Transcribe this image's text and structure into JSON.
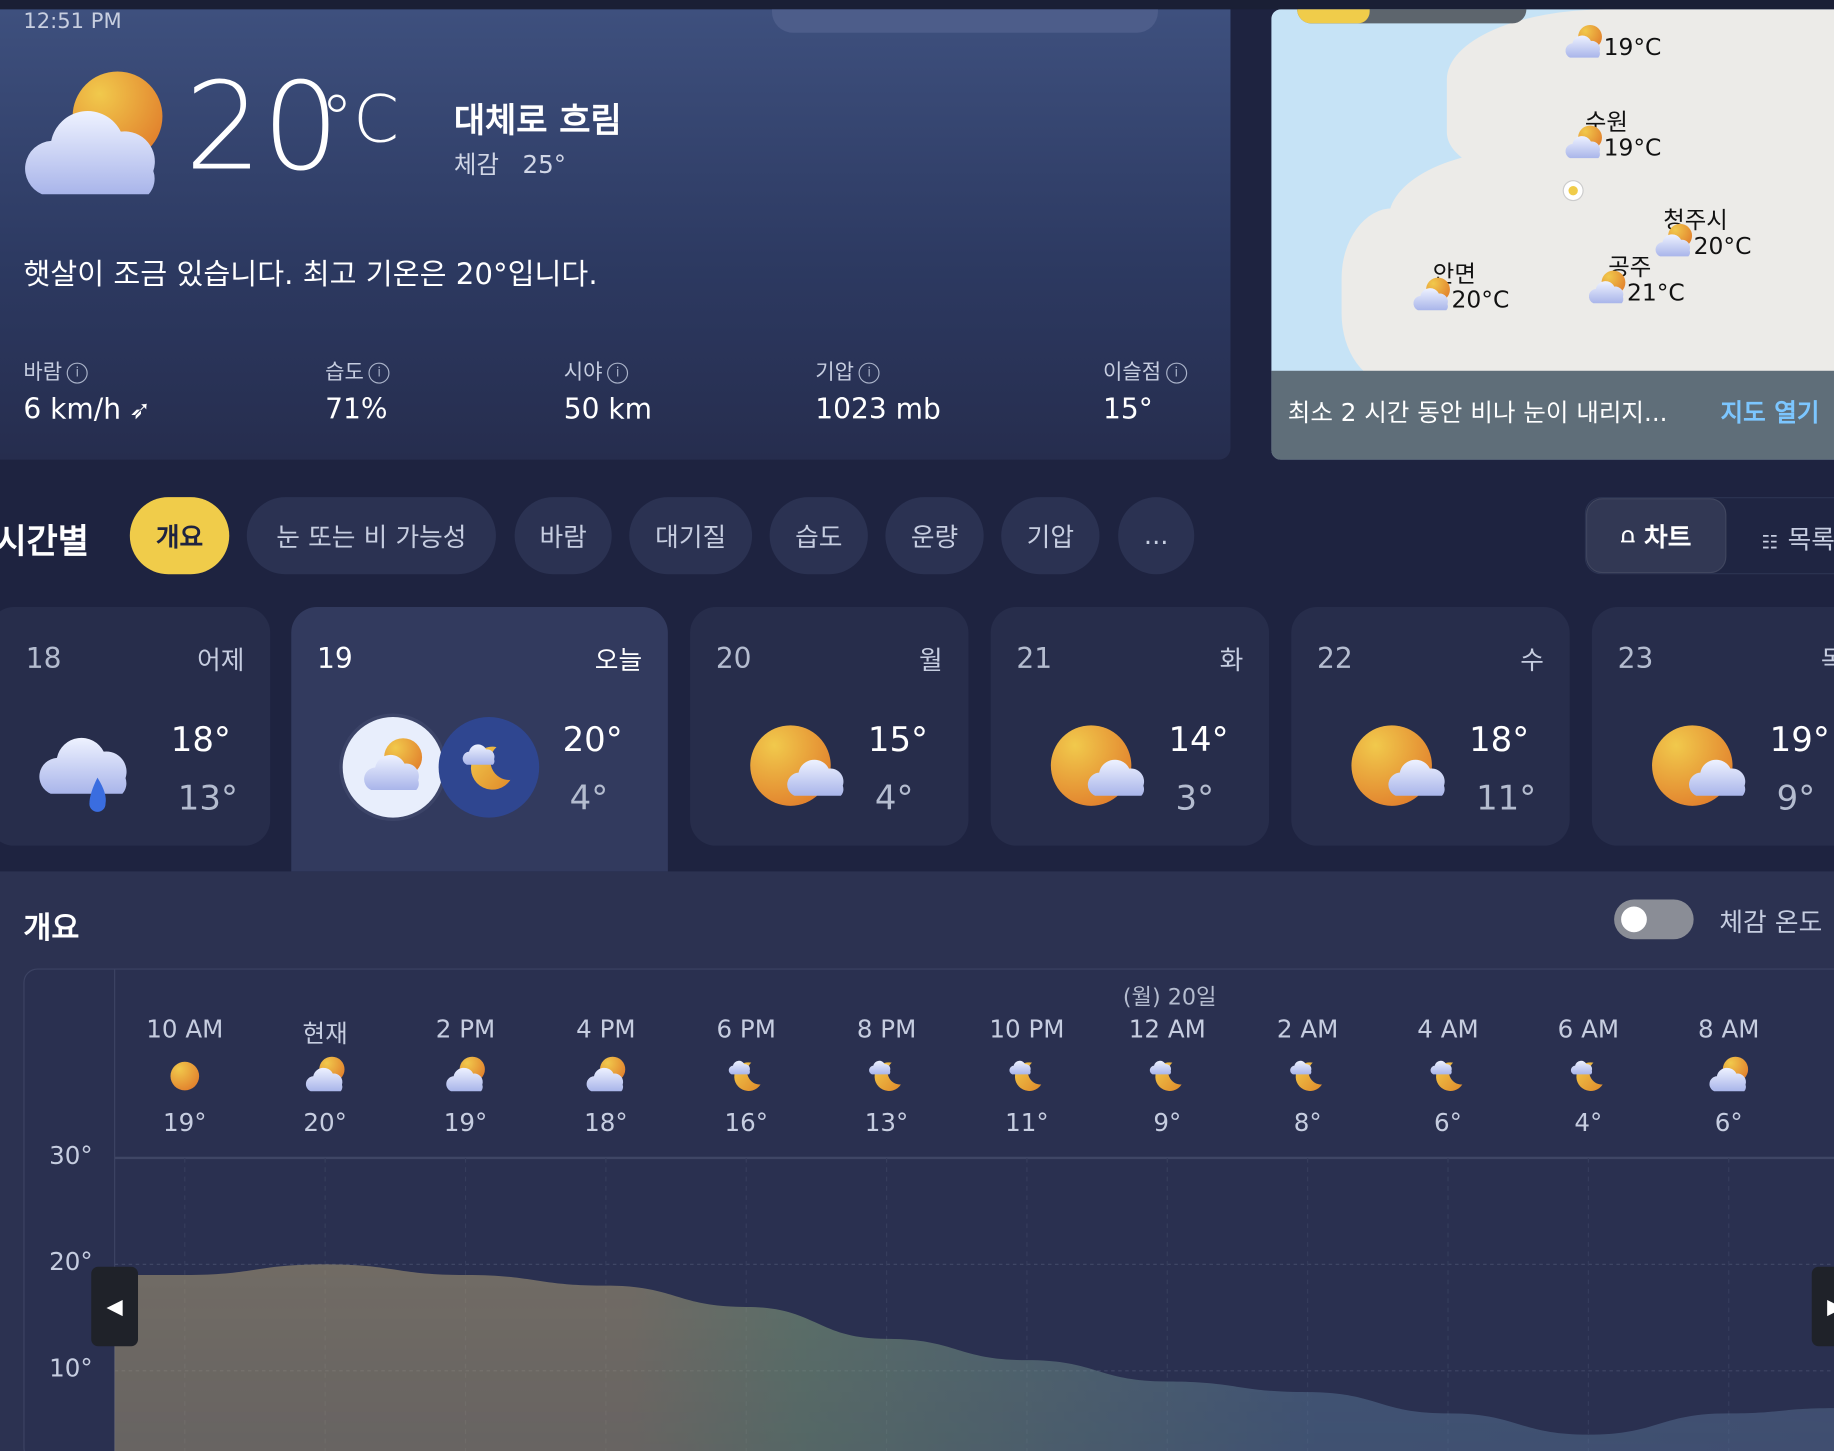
{
  "current": {
    "time": "12:51 PM",
    "temperature": "20",
    "unit": "°C",
    "condition": "대체로 흐림",
    "feels_like_label": "체감",
    "feels_like_value": "25°",
    "icon": "partly-sunny",
    "summary": "햇살이 조금 있습니다. 최고 기온은 20°입니다.",
    "stats": [
      {
        "label": "바람",
        "value": "6 km/h"
      },
      {
        "label": "습도",
        "value": "71%"
      },
      {
        "label": "시야",
        "value": "50 km"
      },
      {
        "label": "기압",
        "value": "1023 mb"
      },
      {
        "label": "이슬점",
        "value": "15°"
      }
    ],
    "info_icon": "i"
  },
  "map": {
    "markers": [
      {
        "name": "",
        "temp": "19°C"
      },
      {
        "name": "수원",
        "temp": "19°C"
      },
      {
        "name": "청주시",
        "temp": "20°C"
      },
      {
        "name": "공주",
        "temp": "21°C"
      },
      {
        "name": "안면",
        "temp": "20°C"
      }
    ],
    "message": "최소 2 시간 동안 비나 눈이 내리지...",
    "open_link": "지도 열기"
  },
  "hourly": {
    "title": "시간별",
    "tabs": [
      "개요",
      "눈 또는 비 가능성",
      "바람",
      "대기질",
      "습도",
      "운량",
      "기압",
      "..."
    ],
    "active_tab": 0,
    "view_chart": "차트",
    "view_list": "목록"
  },
  "days": [
    {
      "date": "18",
      "name": "어제",
      "hi": "18°",
      "lo": "13°",
      "icon": "rain"
    },
    {
      "date": "19",
      "name": "오늘",
      "hi": "20°",
      "lo": "4°",
      "icon": "day-night"
    },
    {
      "date": "20",
      "name": "월",
      "hi": "15°",
      "lo": "4°",
      "icon": "sun-cloud"
    },
    {
      "date": "21",
      "name": "화",
      "hi": "14°",
      "lo": "3°",
      "icon": "sun-cloud"
    },
    {
      "date": "22",
      "name": "수",
      "hi": "18°",
      "lo": "11°",
      "icon": "sun-cloud"
    },
    {
      "date": "23",
      "name": "목",
      "hi": "19°",
      "lo": "9°",
      "icon": "sun-cloud"
    }
  ],
  "overview": {
    "title": "개요",
    "feels_toggle_label": "체감 온도",
    "feels_toggle_on": false,
    "date_marker": "(월) 20일"
  },
  "chart_data": {
    "type": "area",
    "title": "개요",
    "x": [
      "10 AM",
      "현재",
      "2 PM",
      "4 PM",
      "6 PM",
      "8 PM",
      "10 PM",
      "12 AM",
      "2 AM",
      "4 AM",
      "6 AM",
      "8 AM"
    ],
    "values": [
      19,
      20,
      19,
      18,
      16,
      13,
      11,
      9,
      8,
      6,
      4,
      6
    ],
    "value_labels": [
      "19°",
      "20°",
      "19°",
      "18°",
      "16°",
      "13°",
      "11°",
      "9°",
      "8°",
      "6°",
      "4°",
      "6°"
    ],
    "icons": [
      "sunny",
      "partly-sunny",
      "partly-sunny",
      "partly-sunny",
      "cloudy-night",
      "cloudy-night",
      "cloudy-night",
      "cloudy-night",
      "cloudy-night",
      "cloudy-night",
      "cloudy-night",
      "partly-sunny"
    ],
    "yticks": [
      "30°",
      "20°",
      "10°"
    ],
    "ytick_values": [
      30,
      20,
      10
    ],
    "ylim": [
      3,
      30
    ],
    "grid": true,
    "colors": {
      "warm": "#b3a378",
      "mid": "#8aaa80",
      "cool": "#5a7a9a"
    }
  }
}
